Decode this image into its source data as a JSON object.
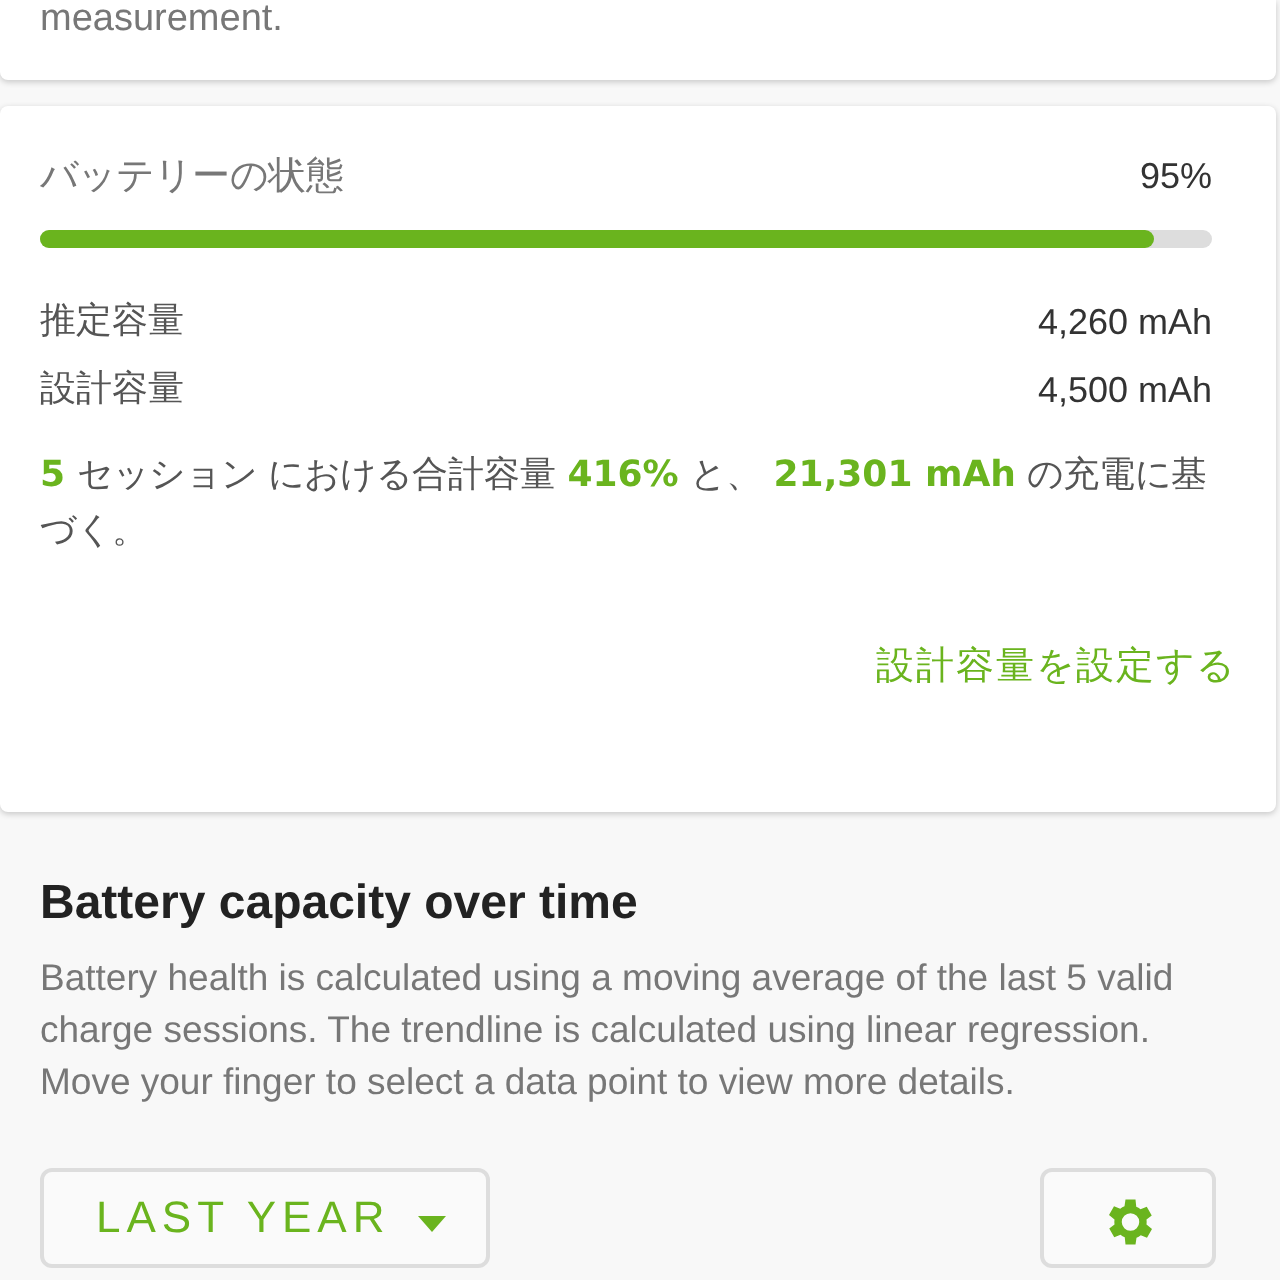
{
  "previous_card": {
    "text_tail": "measurement."
  },
  "health_card": {
    "title": "バッテリーの状態",
    "percent": "95%",
    "level": 0.95,
    "rows": [
      {
        "label": "推定容量",
        "value": "4,260 mAh"
      },
      {
        "label": "設計容量",
        "value": "4,500 mAh"
      }
    ],
    "summary": "**5** セッション における合計容量 **416%** と、 **21,301 mAh** の充電に基づく。",
    "action": "設計容量を設定する"
  },
  "capacity_section": {
    "title": "Battery capacity over time",
    "description": "Battery health is calculated using a moving average of the last 5 valid charge sessions. The trendline is calculated using linear regression. Move your finger to select a data point to view more details.",
    "range_button": "LAST YEAR"
  }
}
